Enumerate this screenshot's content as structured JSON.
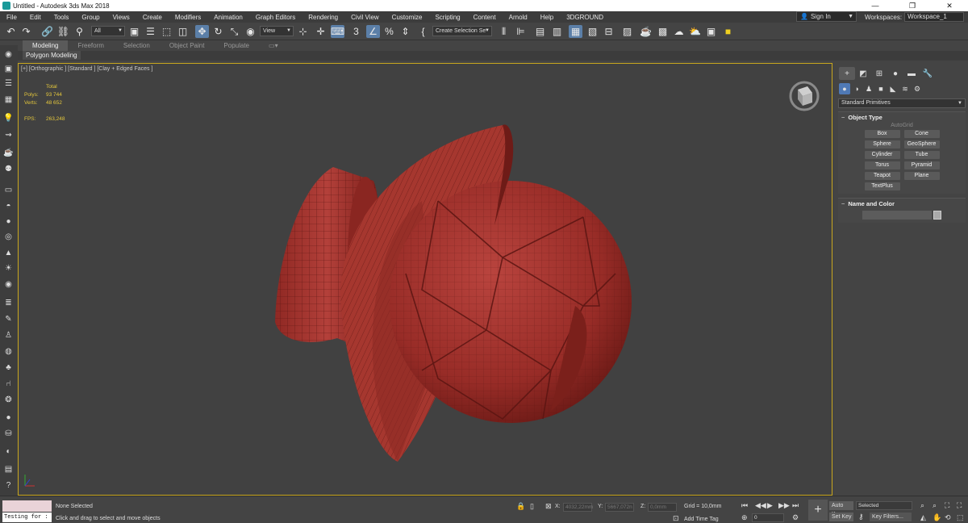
{
  "window": {
    "title": "Untitled - Autodesk 3ds Max 2018",
    "minimize": "—",
    "maximize": "❐",
    "close": "✕"
  },
  "menu": [
    "File",
    "Edit",
    "Tools",
    "Group",
    "Views",
    "Create",
    "Modifiers",
    "Animation",
    "Graph Editors",
    "Rendering",
    "Civil View",
    "Customize",
    "Scripting",
    "Content",
    "Arnold",
    "Help",
    "3DGROUND"
  ],
  "account": {
    "sign_in": "Sign In",
    "workspaces_label": "Workspaces:",
    "workspace_value": "Workspace_1"
  },
  "toolbar": {
    "filter_value": "All",
    "ref_coord_value": "View",
    "selection_set_value": "Create Selection Se"
  },
  "ribbon": {
    "tabs": [
      "Modeling",
      "Freeform",
      "Selection",
      "Object Paint",
      "Populate"
    ],
    "active_tab": "Modeling",
    "sub_label": "Polygon Modeling"
  },
  "viewport": {
    "label": "[+] [Orthographic ] [Standard ] [Clay + Edged Faces ]",
    "stats": {
      "total_label": "Total",
      "polys_label": "Polys:",
      "polys_value": "93 744",
      "verts_label": "Verts:",
      "verts_value": "48 652",
      "fps_label": "FPS:",
      "fps_value": "263,248"
    },
    "colors": {
      "model": "#9c2f2a",
      "model_dark": "#6b1916",
      "border_active": "#c9a71e",
      "stats_text": "#e4c73c"
    }
  },
  "command_panel": {
    "category": "Standard Primitives",
    "object_type_title": "Object Type",
    "autogrid": "AutoGrid",
    "primitives": [
      "Box",
      "Cone",
      "Sphere",
      "GeoSphere",
      "Cylinder",
      "Tube",
      "Torus",
      "Pyramid",
      "Teapot",
      "Plane",
      "TextPlus"
    ],
    "name_color_title": "Name and Color",
    "toggle": "+"
  },
  "status": {
    "script_testing": "Testing for :",
    "selection": "None Selected",
    "prompt": "Click and drag to select and move objects",
    "x_label": "X:",
    "x_value": "4032,22mm",
    "y_label": "Y:",
    "y_value": "5667,072n",
    "z_label": "Z:",
    "z_value": "0,0mm",
    "grid": "Grid = 10,0mm",
    "add_time_tag": "Add Time Tag",
    "frame_value": "0",
    "auto_key": "Auto Key",
    "selected_value": "Selected",
    "set_key": "Set Key",
    "key_filters": "Key Filters..."
  }
}
